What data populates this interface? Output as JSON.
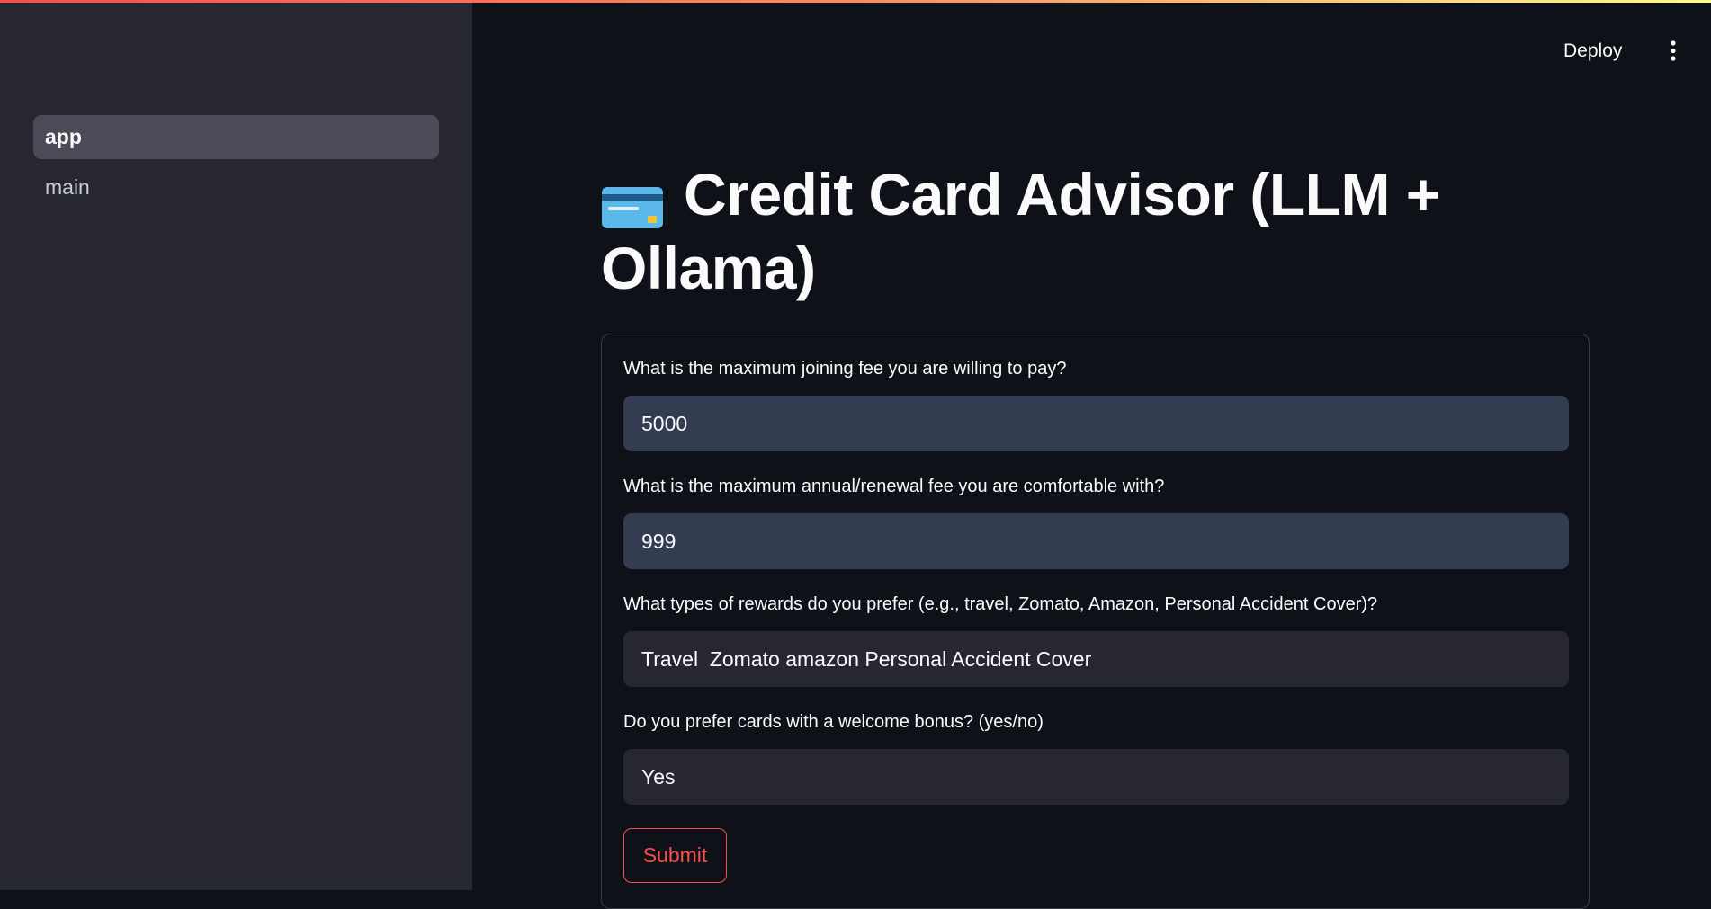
{
  "sidebar": {
    "items": [
      {
        "label": "app",
        "active": true
      },
      {
        "label": "main",
        "active": false
      }
    ]
  },
  "header": {
    "deploy_label": "Deploy",
    "menu_icon": "vertical-ellipsis-icon"
  },
  "main": {
    "title_icon": "credit-card-icon",
    "title": "Credit Card Advisor (LLM + Ollama)"
  },
  "form": {
    "fields": [
      {
        "label": "What is the maximum joining fee you are willing to pay?",
        "value": "5000"
      },
      {
        "label": "What is the maximum annual/renewal fee you are comfortable with?",
        "value": "999"
      },
      {
        "label": "What types of rewards do you prefer (e.g., travel, Zomato, Amazon, Personal Accident Cover)?",
        "value": "Travel  Zomato amazon Personal Accident Cover"
      },
      {
        "label": "Do you prefer cards with a welcome bonus? (yes/no)",
        "value": "Yes"
      }
    ],
    "submit_label": "Submit"
  },
  "colors": {
    "background": "#0e1117",
    "sidebar": "#262730",
    "accent": "#ff4b4b",
    "number_input": "#343c52",
    "text_input": "#262730"
  }
}
